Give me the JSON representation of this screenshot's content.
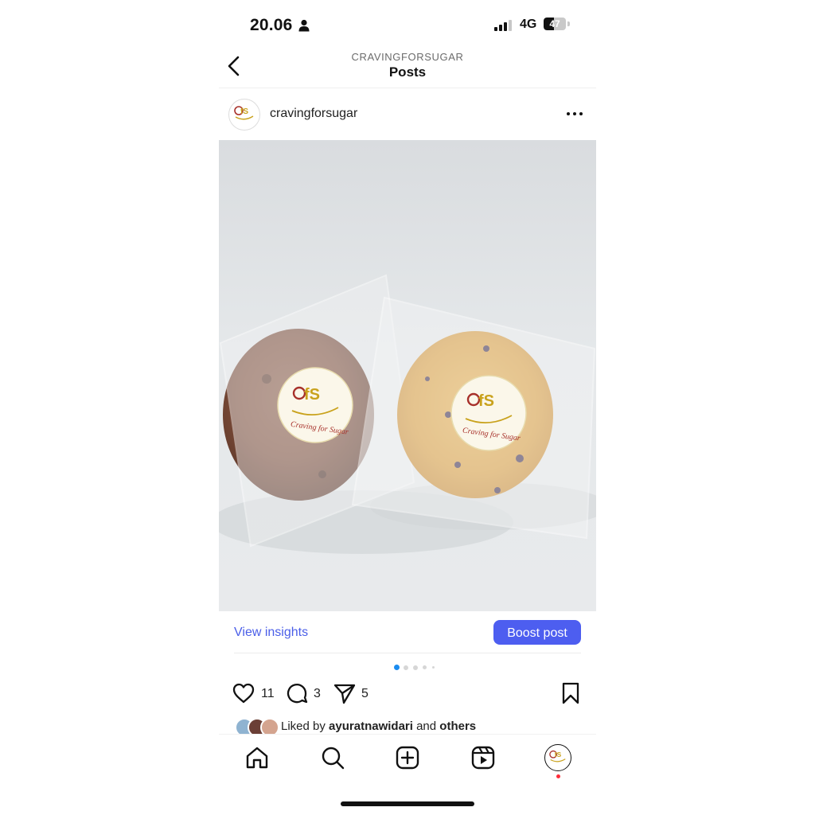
{
  "status_bar": {
    "time": "20.06",
    "network": "4G",
    "battery": "47",
    "battery_level": 0.47
  },
  "header": {
    "subtitle": "CRAVINGFORSUGAR",
    "title": "Posts"
  },
  "post": {
    "username": "cravingforsugar",
    "image": {
      "sticker_logo": "CfS",
      "sticker_text": "Craving for Sugar",
      "sticker_color": "#c9a21c",
      "sticker_accent": "#a7302a"
    },
    "insights": {
      "view_label": "View insights",
      "boost_label": "Boost post"
    },
    "carousel": {
      "total": 5,
      "active": 1
    },
    "likes": "11",
    "comments": "3",
    "shares": "5",
    "liked_by": {
      "prefix": "Liked by",
      "user": "ayuratnawidari",
      "and": "and",
      "others": "others"
    }
  },
  "colors": {
    "accent": "#4d5ef0",
    "link": "#4a5ee8",
    "carousel_active": "#1a8cf0",
    "notification": "#ff2d3a"
  },
  "tabbar": {
    "items": [
      "home-icon",
      "search-icon",
      "create-icon",
      "reels-icon",
      "profile-icon"
    ]
  }
}
